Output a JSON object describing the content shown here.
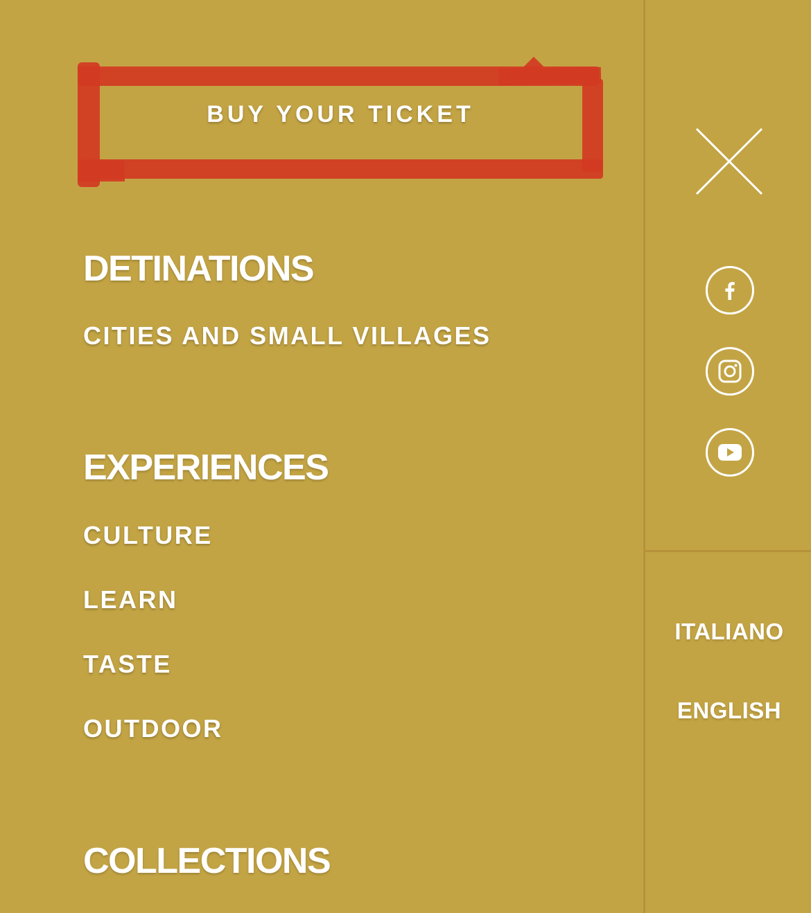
{
  "ticket_button": {
    "label": "BUY YOUR TICKET"
  },
  "sections": [
    {
      "title": "DETINATIONS",
      "items": [
        "CITIES AND SMALL VILLAGES"
      ]
    },
    {
      "title": "EXPERIENCES",
      "items": [
        "CULTURE",
        "LEARN",
        "TASTE",
        "OUTDOOR"
      ]
    },
    {
      "title": "COLLECTIONS",
      "items": []
    }
  ],
  "social": {
    "icons": [
      "facebook-icon",
      "instagram-icon",
      "youtube-icon"
    ]
  },
  "languages": [
    "ITALIANO",
    "ENGLISH"
  ],
  "colors": {
    "background": "#c3a444",
    "highlight": "#d23a22",
    "text": "#ffffff",
    "divider": "#b5923a"
  }
}
